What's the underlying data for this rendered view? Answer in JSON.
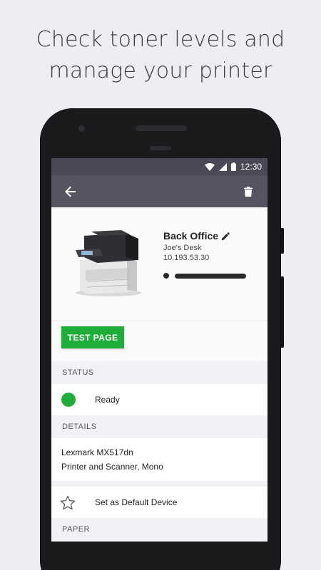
{
  "headline": {
    "line1": "Check toner levels and",
    "line2": "manage your printer"
  },
  "status_bar": {
    "time": "12:30",
    "icons": [
      "wifi-icon",
      "signal-icon",
      "battery-icon"
    ]
  },
  "app_bar": {
    "back_icon": "back-arrow-icon",
    "delete_icon": "trash-icon"
  },
  "device": {
    "name": "Back Office",
    "location": "Joe's Desk",
    "ip": "10.193.53.30",
    "edit_icon": "pencil-icon",
    "toner_level_percent": 100
  },
  "actions": {
    "test_page_label": "TEST PAGE"
  },
  "sections": {
    "status": "STATUS",
    "details": "DETAILS",
    "paper": "PAPER"
  },
  "status": {
    "text": "Ready",
    "color": "#1fae3a"
  },
  "details": {
    "model": "Lexmark MX517dn",
    "type": "Printer and Scanner, Mono"
  },
  "default_device": {
    "label": "Set as Default Device",
    "icon": "star-outline-icon"
  },
  "colors": {
    "accent": "#1fae3a",
    "app_bar": "#555561",
    "status_bar": "#4a4a56"
  }
}
